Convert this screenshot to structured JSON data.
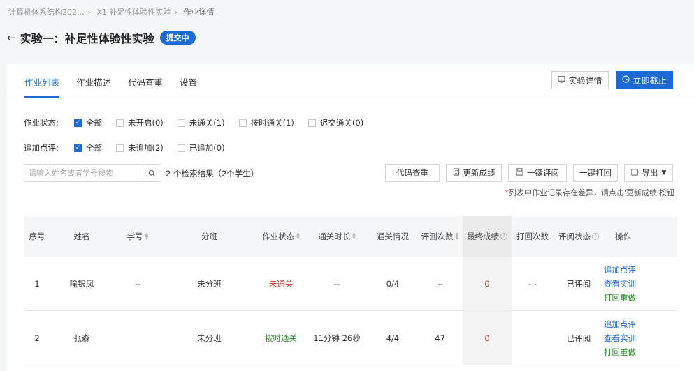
{
  "breadcrumb": [
    "计算机体系结构202...",
    "X1 补足性体验性实验",
    "作业详情"
  ],
  "title": "实验一：补足性体验性实验",
  "status_badge": "提交中",
  "tabs": [
    "作业列表",
    "作业描述",
    "代码查重",
    "设置"
  ],
  "buttons": {
    "experiment_detail": "实验详情",
    "submit_now": "立即截止"
  },
  "filters": {
    "status_label": "作业状态:",
    "status_options": [
      {
        "label": "全部",
        "checked": true
      },
      {
        "label": "未开启(0)",
        "checked": false
      },
      {
        "label": "未通关(1)",
        "checked": false
      },
      {
        "label": "按时通关(1)",
        "checked": false
      },
      {
        "label": "迟交通关(0)",
        "checked": false
      }
    ],
    "comment_label": "追加点评:",
    "comment_options": [
      {
        "label": "全部",
        "checked": true
      },
      {
        "label": "未追加(2)",
        "checked": false
      },
      {
        "label": "已追加(0)",
        "checked": false
      }
    ]
  },
  "search": {
    "placeholder": "请输入姓名或者学号搜索",
    "result_text": "2 个检索结果（2个学生）"
  },
  "toolbar": {
    "code_check": "代码查重",
    "update_score": "更新成绩",
    "batch_review": "一键评阅",
    "batch_return": "一键打回",
    "export": "导出"
  },
  "hint": "列表中作业记录存在差异，请点击'更新成绩'按钮",
  "table": {
    "headers": [
      "序号",
      "姓名",
      "学号",
      "分班",
      "作业状态",
      "通关时长",
      "通关情况",
      "评测次数",
      "最终成绩",
      "打回次数",
      "评阅状态",
      "操作"
    ],
    "rows": [
      {
        "index": "1",
        "name": "喻银凤",
        "student_id": "--",
        "class": "未分班",
        "status": "未通关",
        "duration": "--",
        "progress": "0/4",
        "tests": "--",
        "score": "0",
        "returns": "- -",
        "review": "已评阅"
      },
      {
        "index": "2",
        "name": "张森",
        "student_id": "",
        "class": "未分班",
        "status": "按时通关",
        "duration": "11分钟 26秒",
        "progress": "4/4",
        "tests": "47",
        "score": "0",
        "returns": "",
        "review": "已评阅"
      }
    ],
    "ops": [
      "追加点评",
      "查看实训",
      "打回重做"
    ]
  }
}
